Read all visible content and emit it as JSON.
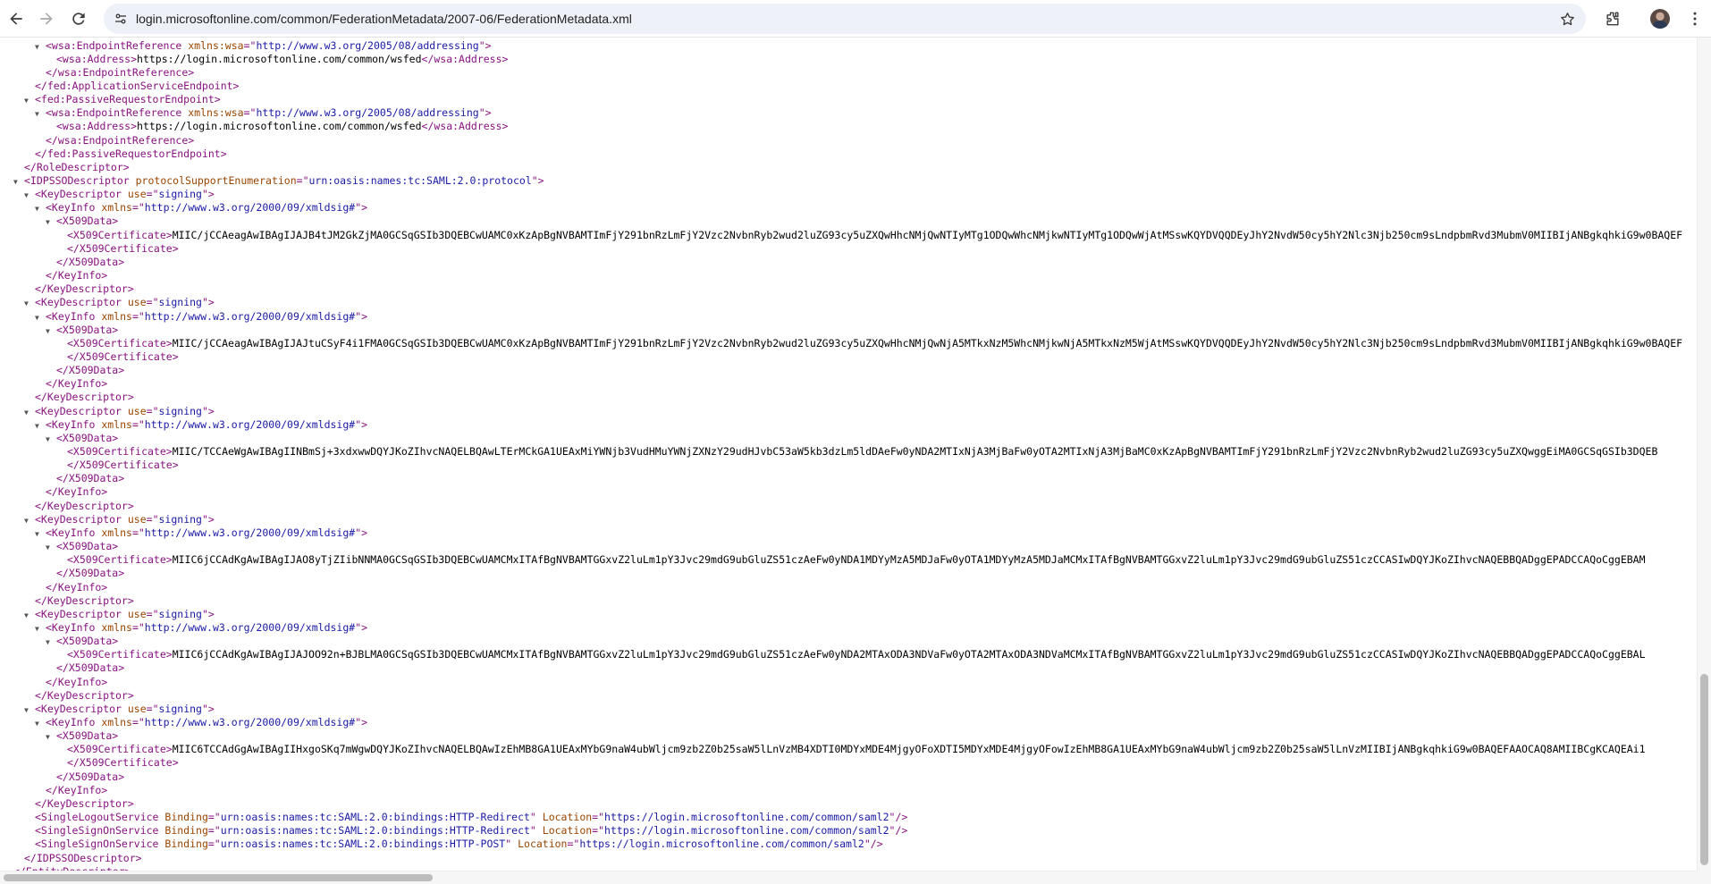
{
  "browser": {
    "url": "login.microsoftonline.com/common/FederationMetadata/2007-06/FederationMetadata.xml"
  },
  "xml_lines": [
    {
      "indent": 3,
      "fold": true,
      "segments": [
        [
          "t",
          "<wsa:EndpointReference"
        ],
        [
          "a",
          " xmlns:wsa"
        ],
        [
          "t",
          "=\""
        ],
        [
          "v",
          "http://www.w3.org/2005/08/addressing"
        ],
        [
          "t",
          "\">"
        ]
      ]
    },
    {
      "indent": 4,
      "fold": false,
      "segments": [
        [
          "t",
          "<wsa:Address>"
        ],
        [
          "x",
          "https://login.microsoftonline.com/common/wsfed"
        ],
        [
          "t",
          "</wsa:Address>"
        ]
      ]
    },
    {
      "indent": 3,
      "fold": false,
      "segments": [
        [
          "t",
          "</wsa:EndpointReference>"
        ]
      ]
    },
    {
      "indent": 2,
      "fold": false,
      "segments": [
        [
          "t",
          "</fed:ApplicationServiceEndpoint>"
        ]
      ]
    },
    {
      "indent": 2,
      "fold": true,
      "segments": [
        [
          "t",
          "<fed:PassiveRequestorEndpoint>"
        ]
      ]
    },
    {
      "indent": 3,
      "fold": true,
      "segments": [
        [
          "t",
          "<wsa:EndpointReference"
        ],
        [
          "a",
          " xmlns:wsa"
        ],
        [
          "t",
          "=\""
        ],
        [
          "v",
          "http://www.w3.org/2005/08/addressing"
        ],
        [
          "t",
          "\">"
        ]
      ]
    },
    {
      "indent": 4,
      "fold": false,
      "segments": [
        [
          "t",
          "<wsa:Address>"
        ],
        [
          "x",
          "https://login.microsoftonline.com/common/wsfed"
        ],
        [
          "t",
          "</wsa:Address>"
        ]
      ]
    },
    {
      "indent": 3,
      "fold": false,
      "segments": [
        [
          "t",
          "</wsa:EndpointReference>"
        ]
      ]
    },
    {
      "indent": 2,
      "fold": false,
      "segments": [
        [
          "t",
          "</fed:PassiveRequestorEndpoint>"
        ]
      ]
    },
    {
      "indent": 1,
      "fold": false,
      "segments": [
        [
          "t",
          "</RoleDescriptor>"
        ]
      ]
    },
    {
      "indent": 1,
      "fold": true,
      "segments": [
        [
          "t",
          "<IDPSSODescriptor"
        ],
        [
          "a",
          " protocolSupportEnumeration"
        ],
        [
          "t",
          "=\""
        ],
        [
          "v",
          "urn:oasis:names:tc:SAML:2.0:protocol"
        ],
        [
          "t",
          "\">"
        ]
      ]
    },
    {
      "indent": 2,
      "fold": true,
      "segments": [
        [
          "t",
          "<KeyDescriptor"
        ],
        [
          "a",
          " use"
        ],
        [
          "t",
          "=\""
        ],
        [
          "v",
          "signing"
        ],
        [
          "t",
          "\">"
        ]
      ]
    },
    {
      "indent": 3,
      "fold": true,
      "segments": [
        [
          "t",
          "<KeyInfo"
        ],
        [
          "a",
          " xmlns"
        ],
        [
          "t",
          "=\""
        ],
        [
          "v",
          "http://www.w3.org/2000/09/xmldsig#"
        ],
        [
          "t",
          "\">"
        ]
      ]
    },
    {
      "indent": 4,
      "fold": true,
      "segments": [
        [
          "t",
          "<X509Data>"
        ]
      ]
    },
    {
      "indent": 5,
      "fold": false,
      "segments": [
        [
          "t",
          "<X509Certificate>"
        ],
        [
          "x",
          "MIIC/jCCAeagAwIBAgIJAJB4tJM2GkZjMA0GCSqGSIb3DQEBCwUAMC0xKzApBgNVBAMTImFjY291bnRzLmFjY2Vzc2NvbnRyb2wud2luZG93cy5uZXQwHhcNMjQwNTIyMTg1ODQwWhcNMjkwNTIyMTg1ODQwWjAtMSswKQYDVQQDEyJhY2NvdW50cy5hY2Nlc3Njb250cm9sLndpbmRvd3MubmV0MIIBIjANBgkqhkiG9w0BAQEF"
        ]
      ]
    },
    {
      "indent": 5,
      "fold": false,
      "segments": [
        [
          "t",
          "</X509Certificate>"
        ]
      ]
    },
    {
      "indent": 4,
      "fold": false,
      "segments": [
        [
          "t",
          "</X509Data>"
        ]
      ]
    },
    {
      "indent": 3,
      "fold": false,
      "segments": [
        [
          "t",
          "</KeyInfo>"
        ]
      ]
    },
    {
      "indent": 2,
      "fold": false,
      "segments": [
        [
          "t",
          "</KeyDescriptor>"
        ]
      ]
    },
    {
      "indent": 2,
      "fold": true,
      "segments": [
        [
          "t",
          "<KeyDescriptor"
        ],
        [
          "a",
          " use"
        ],
        [
          "t",
          "=\""
        ],
        [
          "v",
          "signing"
        ],
        [
          "t",
          "\">"
        ]
      ]
    },
    {
      "indent": 3,
      "fold": true,
      "segments": [
        [
          "t",
          "<KeyInfo"
        ],
        [
          "a",
          " xmlns"
        ],
        [
          "t",
          "=\""
        ],
        [
          "v",
          "http://www.w3.org/2000/09/xmldsig#"
        ],
        [
          "t",
          "\">"
        ]
      ]
    },
    {
      "indent": 4,
      "fold": true,
      "segments": [
        [
          "t",
          "<X509Data>"
        ]
      ]
    },
    {
      "indent": 5,
      "fold": false,
      "segments": [
        [
          "t",
          "<X509Certificate>"
        ],
        [
          "x",
          "MIIC/jCCAeagAwIBAgIJAJtuCSyF4i1FMA0GCSqGSIb3DQEBCwUAMC0xKzApBgNVBAMTImFjY291bnRzLmFjY2Vzc2NvbnRyb2wud2luZG93cy5uZXQwHhcNMjQwNjA5MTkxNzM5WhcNMjkwNjA5MTkxNzM5WjAtMSswKQYDVQQDEyJhY2NvdW50cy5hY2Nlc3Njb250cm9sLndpbmRvd3MubmV0MIIBIjANBgkqhkiG9w0BAQEF"
        ]
      ]
    },
    {
      "indent": 5,
      "fold": false,
      "segments": [
        [
          "t",
          "</X509Certificate>"
        ]
      ]
    },
    {
      "indent": 4,
      "fold": false,
      "segments": [
        [
          "t",
          "</X509Data>"
        ]
      ]
    },
    {
      "indent": 3,
      "fold": false,
      "segments": [
        [
          "t",
          "</KeyInfo>"
        ]
      ]
    },
    {
      "indent": 2,
      "fold": false,
      "segments": [
        [
          "t",
          "</KeyDescriptor>"
        ]
      ]
    },
    {
      "indent": 2,
      "fold": true,
      "segments": [
        [
          "t",
          "<KeyDescriptor"
        ],
        [
          "a",
          " use"
        ],
        [
          "t",
          "=\""
        ],
        [
          "v",
          "signing"
        ],
        [
          "t",
          "\">"
        ]
      ]
    },
    {
      "indent": 3,
      "fold": true,
      "segments": [
        [
          "t",
          "<KeyInfo"
        ],
        [
          "a",
          " xmlns"
        ],
        [
          "t",
          "=\""
        ],
        [
          "v",
          "http://www.w3.org/2000/09/xmldsig#"
        ],
        [
          "t",
          "\">"
        ]
      ]
    },
    {
      "indent": 4,
      "fold": true,
      "segments": [
        [
          "t",
          "<X509Data>"
        ]
      ]
    },
    {
      "indent": 5,
      "fold": false,
      "segments": [
        [
          "t",
          "<X509Certificate>"
        ],
        [
          "x",
          "MIIC/TCCAeWgAwIBAgIINBmSj+3xdxwwDQYJKoZIhvcNAQELBQAwLTErMCkGA1UEAxMiYWNjb3VudHMuYWNjZXNzY29udHJvbC53aW5kb3dzLm5ldDAeFw0yNDA2MTIxNjA3MjBaFw0yOTA2MTIxNjA3MjBaMC0xKzApBgNVBAMTImFjY291bnRzLmFjY2Vzc2NvbnRyb2wud2luZG93cy5uZXQwggEiMA0GCSqGSIb3DQEB"
        ]
      ]
    },
    {
      "indent": 5,
      "fold": false,
      "segments": [
        [
          "t",
          "</X509Certificate>"
        ]
      ]
    },
    {
      "indent": 4,
      "fold": false,
      "segments": [
        [
          "t",
          "</X509Data>"
        ]
      ]
    },
    {
      "indent": 3,
      "fold": false,
      "segments": [
        [
          "t",
          "</KeyInfo>"
        ]
      ]
    },
    {
      "indent": 2,
      "fold": false,
      "segments": [
        [
          "t",
          "</KeyDescriptor>"
        ]
      ]
    },
    {
      "indent": 2,
      "fold": true,
      "segments": [
        [
          "t",
          "<KeyDescriptor"
        ],
        [
          "a",
          " use"
        ],
        [
          "t",
          "=\""
        ],
        [
          "v",
          "signing"
        ],
        [
          "t",
          "\">"
        ]
      ]
    },
    {
      "indent": 3,
      "fold": true,
      "segments": [
        [
          "t",
          "<KeyInfo"
        ],
        [
          "a",
          " xmlns"
        ],
        [
          "t",
          "=\""
        ],
        [
          "v",
          "http://www.w3.org/2000/09/xmldsig#"
        ],
        [
          "t",
          "\">"
        ]
      ]
    },
    {
      "indent": 4,
      "fold": true,
      "segments": [
        [
          "t",
          "<X509Data>"
        ]
      ]
    },
    {
      "indent": 5,
      "fold": false,
      "segments": [
        [
          "t",
          "<X509Certificate>"
        ],
        [
          "x",
          "MIIC6jCCAdKgAwIBAgIJAO8yTjZIibNNMA0GCSqGSIb3DQEBCwUAMCMxITAfBgNVBAMTGGxvZ2luLm1pY3Jvc29mdG9ubGluZS51czAeFw0yNDA1MDYyMzA5MDJaFw0yOTA1MDYyMzA5MDJaMCMxITAfBgNVBAMTGGxvZ2luLm1pY3Jvc29mdG9ubGluZS51czCCASIwDQYJKoZIhvcNAQEBBQADggEPADCCAQoCggEBAM"
        ]
      ]
    },
    {
      "indent": 4,
      "fold": false,
      "segments": [
        [
          "t",
          "</X509Data>"
        ]
      ]
    },
    {
      "indent": 3,
      "fold": false,
      "segments": [
        [
          "t",
          "</KeyInfo>"
        ]
      ]
    },
    {
      "indent": 2,
      "fold": false,
      "segments": [
        [
          "t",
          "</KeyDescriptor>"
        ]
      ]
    },
    {
      "indent": 2,
      "fold": true,
      "segments": [
        [
          "t",
          "<KeyDescriptor"
        ],
        [
          "a",
          " use"
        ],
        [
          "t",
          "=\""
        ],
        [
          "v",
          "signing"
        ],
        [
          "t",
          "\">"
        ]
      ]
    },
    {
      "indent": 3,
      "fold": true,
      "segments": [
        [
          "t",
          "<KeyInfo"
        ],
        [
          "a",
          " xmlns"
        ],
        [
          "t",
          "=\""
        ],
        [
          "v",
          "http://www.w3.org/2000/09/xmldsig#"
        ],
        [
          "t",
          "\">"
        ]
      ]
    },
    {
      "indent": 4,
      "fold": true,
      "segments": [
        [
          "t",
          "<X509Data>"
        ]
      ]
    },
    {
      "indent": 5,
      "fold": false,
      "segments": [
        [
          "t",
          "<X509Certificate>"
        ],
        [
          "x",
          "MIIC6jCCAdKgAwIBAgIJAJOO92n+BJBLMA0GCSqGSIb3DQEBCwUAMCMxITAfBgNVBAMTGGxvZ2luLm1pY3Jvc29mdG9ubGluZS51czAeFw0yNDA2MTAxODA3NDVaFw0yOTA2MTAxODA3NDVaMCMxITAfBgNVBAMTGGxvZ2luLm1pY3Jvc29mdG9ubGluZS51czCCASIwDQYJKoZIhvcNAQEBBQADggEPADCCAQoCggEBAL"
        ]
      ]
    },
    {
      "indent": 4,
      "fold": false,
      "segments": [
        [
          "t",
          "</X509Data>"
        ]
      ]
    },
    {
      "indent": 3,
      "fold": false,
      "segments": [
        [
          "t",
          "</KeyInfo>"
        ]
      ]
    },
    {
      "indent": 2,
      "fold": false,
      "segments": [
        [
          "t",
          "</KeyDescriptor>"
        ]
      ]
    },
    {
      "indent": 2,
      "fold": true,
      "segments": [
        [
          "t",
          "<KeyDescriptor"
        ],
        [
          "a",
          " use"
        ],
        [
          "t",
          "=\""
        ],
        [
          "v",
          "signing"
        ],
        [
          "t",
          "\">"
        ]
      ]
    },
    {
      "indent": 3,
      "fold": true,
      "segments": [
        [
          "t",
          "<KeyInfo"
        ],
        [
          "a",
          " xmlns"
        ],
        [
          "t",
          "=\""
        ],
        [
          "v",
          "http://www.w3.org/2000/09/xmldsig#"
        ],
        [
          "t",
          "\">"
        ]
      ]
    },
    {
      "indent": 4,
      "fold": true,
      "segments": [
        [
          "t",
          "<X509Data>"
        ]
      ]
    },
    {
      "indent": 5,
      "fold": false,
      "segments": [
        [
          "t",
          "<X509Certificate>"
        ],
        [
          "x",
          "MIIC6TCCAdGgAwIBAgIIHxgoSKq7mWgwDQYJKoZIhvcNAQELBQAwIzEhMB8GA1UEAxMYbG9naW4ubWljcm9zb2Z0b25saW5lLnVzMB4XDTI0MDYxMDE4MjgyOFoXDTI5MDYxMDE4MjgyOFowIzEhMB8GA1UEAxMYbG9naW4ubWljcm9zb2Z0b25saW5lLnVzMIIBIjANBgkqhkiG9w0BAQEFAAOCAQ8AMIIBCgKCAQEAi1"
        ]
      ]
    },
    {
      "indent": 5,
      "fold": false,
      "segments": [
        [
          "t",
          "</X509Certificate>"
        ]
      ]
    },
    {
      "indent": 4,
      "fold": false,
      "segments": [
        [
          "t",
          "</X509Data>"
        ]
      ]
    },
    {
      "indent": 3,
      "fold": false,
      "segments": [
        [
          "t",
          "</KeyInfo>"
        ]
      ]
    },
    {
      "indent": 2,
      "fold": false,
      "segments": [
        [
          "t",
          "</KeyDescriptor>"
        ]
      ]
    },
    {
      "indent": 2,
      "fold": false,
      "segments": [
        [
          "t",
          "<SingleLogoutService"
        ],
        [
          "a",
          " Binding"
        ],
        [
          "t",
          "=\""
        ],
        [
          "v",
          "urn:oasis:names:tc:SAML:2.0:bindings:HTTP-Redirect"
        ],
        [
          "t",
          "\""
        ],
        [
          "a",
          " Location"
        ],
        [
          "t",
          "=\""
        ],
        [
          "v",
          "https://login.microsoftonline.com/common/saml2"
        ],
        [
          "t",
          "\"/>"
        ]
      ]
    },
    {
      "indent": 2,
      "fold": false,
      "segments": [
        [
          "t",
          "<SingleSignOnService"
        ],
        [
          "a",
          " Binding"
        ],
        [
          "t",
          "=\""
        ],
        [
          "v",
          "urn:oasis:names:tc:SAML:2.0:bindings:HTTP-Redirect"
        ],
        [
          "t",
          "\""
        ],
        [
          "a",
          " Location"
        ],
        [
          "t",
          "=\""
        ],
        [
          "v",
          "https://login.microsoftonline.com/common/saml2"
        ],
        [
          "t",
          "\"/>"
        ]
      ]
    },
    {
      "indent": 2,
      "fold": false,
      "segments": [
        [
          "t",
          "<SingleSignOnService"
        ],
        [
          "a",
          " Binding"
        ],
        [
          "t",
          "=\""
        ],
        [
          "v",
          "urn:oasis:names:tc:SAML:2.0:bindings:HTTP-POST"
        ],
        [
          "t",
          "\""
        ],
        [
          "a",
          " Location"
        ],
        [
          "t",
          "=\""
        ],
        [
          "v",
          "https://login.microsoftonline.com/common/saml2"
        ],
        [
          "t",
          "\"/>"
        ]
      ]
    },
    {
      "indent": 1,
      "fold": false,
      "segments": [
        [
          "t",
          "</IDPSSODescriptor>"
        ]
      ]
    },
    {
      "indent": 0,
      "fold": false,
      "segments": [
        [
          "t",
          "</EntityDescriptor>"
        ]
      ]
    }
  ]
}
